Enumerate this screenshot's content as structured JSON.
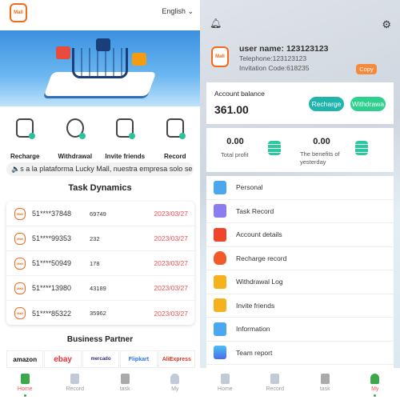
{
  "home": {
    "logo_text": "Mall",
    "language": "English",
    "quick_actions": [
      {
        "label": "Recharge",
        "icon": "wallet-icon"
      },
      {
        "label": "Withdrawal",
        "icon": "coin-icon"
      },
      {
        "label": "Invite friends",
        "icon": "envelope-icon"
      },
      {
        "label": "Record",
        "icon": "document-icon"
      }
    ],
    "marquee": "s a la plataforma Lucky Mall, nuestra empresa solo se",
    "task_dynamics_title": "Task Dynamics",
    "tasks": [
      {
        "phone": "51****37848",
        "amount": "69749",
        "date": "2023/03/27"
      },
      {
        "phone": "51****99353",
        "amount": "232",
        "date": "2023/03/27"
      },
      {
        "phone": "51****50949",
        "amount": "178",
        "date": "2023/03/27"
      },
      {
        "phone": "51****13980",
        "amount": "43189",
        "date": "2023/03/27"
      },
      {
        "phone": "51****85322",
        "amount": "35962",
        "date": "2023/03/27"
      }
    ],
    "partners_title": "Business Partner",
    "partners": [
      "amazon",
      "ebay",
      "mercado",
      "Flipkart",
      "AliExpress"
    ],
    "nav": [
      {
        "label": "Home"
      },
      {
        "label": "Record"
      },
      {
        "label": "task"
      },
      {
        "label": "My"
      }
    ],
    "active_nav": "Home"
  },
  "my": {
    "username": "user name: 123123123",
    "telephone": "Telephone:123123123",
    "invitation": "Invitation Code:618235",
    "copy_label": "Copy",
    "balance_label": "Account balance",
    "balance": "361.00",
    "recharge_label": "Recharge",
    "withdraw_label": "Withdrawa",
    "total_profit": "0.00",
    "total_profit_label": "Total profit",
    "yesterday": "0.00",
    "yesterday_label": "The benefits of yesterday",
    "menu": [
      {
        "label": "Personal",
        "color": "#4aa8f0"
      },
      {
        "label": "Task Record",
        "color": "#8b7cf0"
      },
      {
        "label": "Account details",
        "color": "#f0452a"
      },
      {
        "label": "Recharge record",
        "color": "#f25a2a"
      },
      {
        "label": "Withdrawal Log",
        "color": "#f5b21c"
      },
      {
        "label": "Invite friends",
        "color": "#f5b21c"
      },
      {
        "label": "Information",
        "color": "#4aa8f0"
      },
      {
        "label": "Team report",
        "color": "#4a7cf0"
      }
    ],
    "active_nav": "My"
  },
  "colors": {
    "accent_red": "#f0505a",
    "teal": "#1fb5ad",
    "green": "#2dd08c",
    "orange": "#f7893a"
  }
}
